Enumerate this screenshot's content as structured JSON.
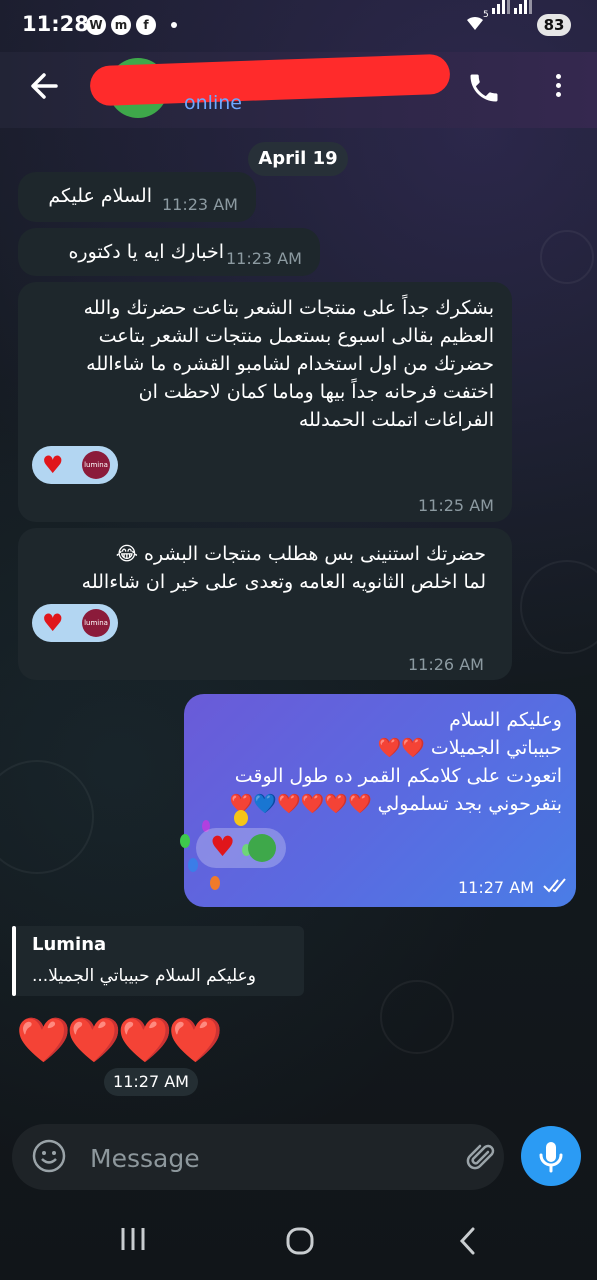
{
  "status_bar": {
    "time": "11:28",
    "signal": "5",
    "battery": "83"
  },
  "header": {
    "presence": "online"
  },
  "date_chip": "April 19",
  "messages": [
    {
      "text": "السلام عليكم",
      "time": "11:23 AM"
    },
    {
      "text": "اخبارك ايه يا دكتوره",
      "time": "11:23 AM"
    },
    {
      "text": "بشكرك جداً على منتجات الشعر بتاعت حضرتك والله\nالعظيم بقالى اسبوع بستعمل منتجات الشعر بتاعت\nحضرتك من اول استخدام لشامبو القشره ما شاءالله\nاختفت فرحانه جداً بيها وماما كمان لاحظت ان\nالفراغات اتملت الحمدلله",
      "time": "11:25 AM"
    },
    {
      "text": "حضرتك استنينى بس هطلب منتجات البشره 😂\nلما اخلص الثانويه العامه وتعدى على خير ان شاءالله",
      "time": "11:26 AM"
    }
  ],
  "outgoing": {
    "text": "وعليكم السلام\nحبيباتي الجميلات ❤️❤️\nاتعودت على كلامكم القمر ده طول الوقت\nبتفرحوني بجد تسلمولي ❤️❤️❤️❤️💙❤️",
    "time": "11:27 AM"
  },
  "reply": {
    "name": "Lumina",
    "quote": "وعليكم السلام حبيباتي الجميلا..."
  },
  "hearts_message": {
    "text": "❤️❤️❤️❤️",
    "time": "11:27 AM"
  },
  "input": {
    "placeholder": "Message"
  },
  "reaction_brand": "lumina",
  "colors": {
    "accent": "#2b9bf4",
    "outgoing_bubble": "#5b69e0",
    "incoming_bubble": "#1e272c",
    "online": "#6ea8ff"
  }
}
